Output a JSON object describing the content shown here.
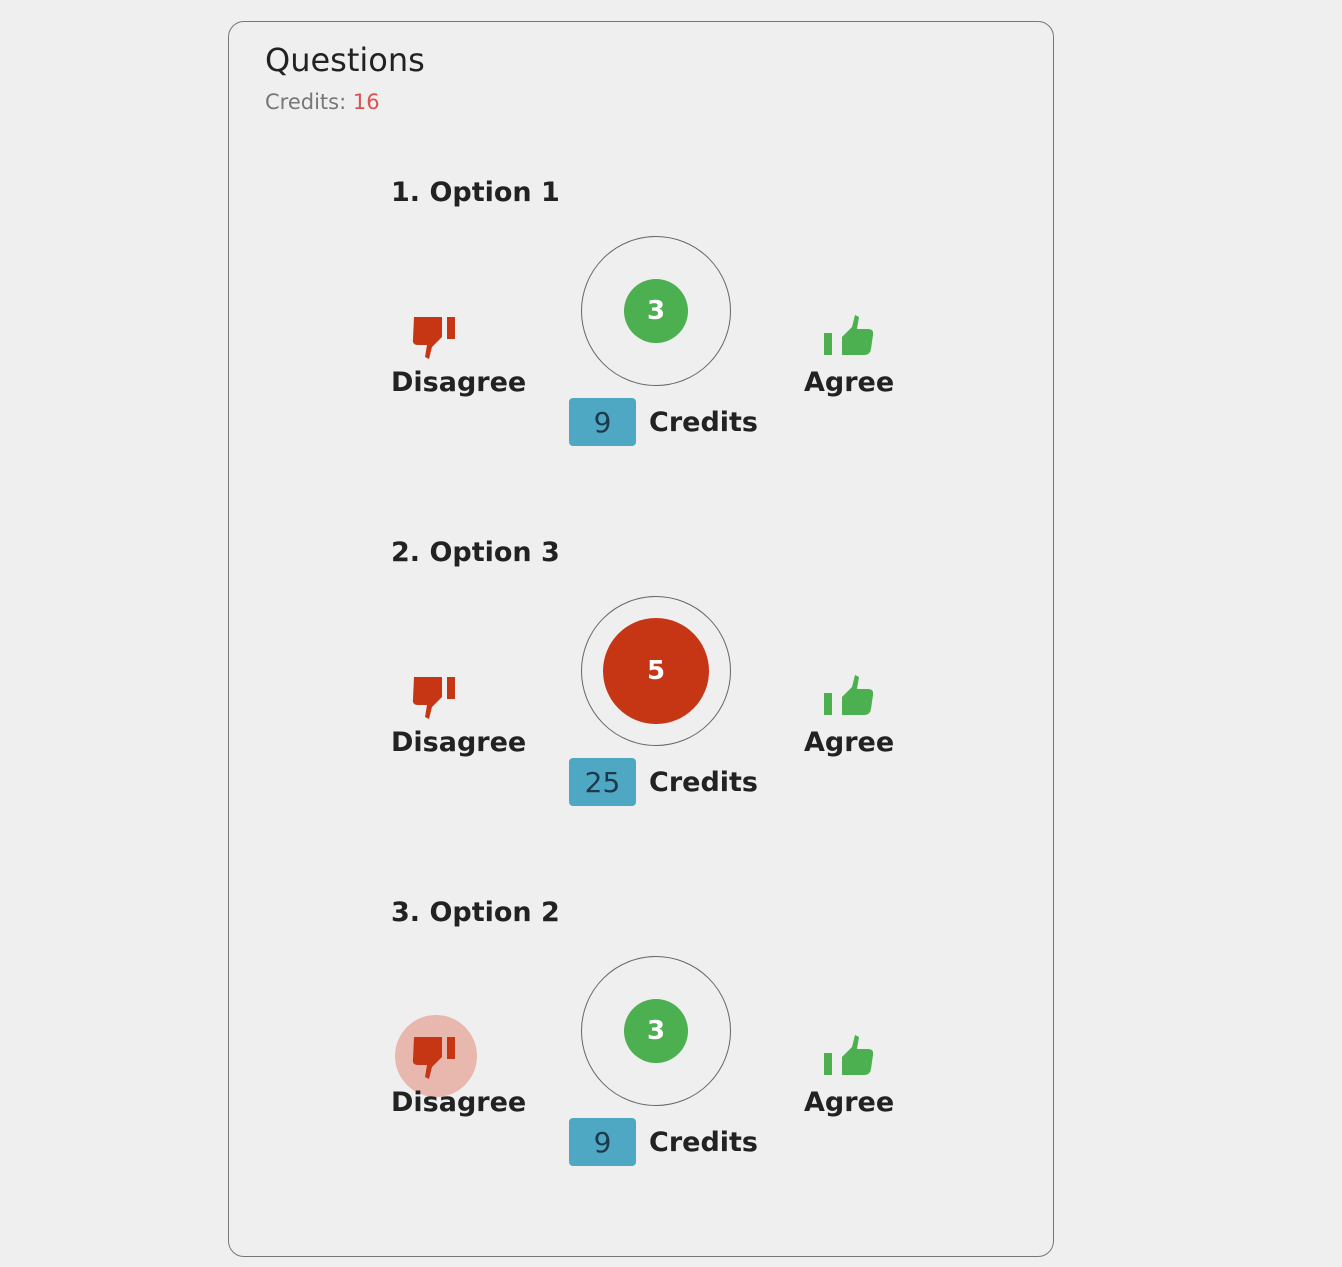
{
  "header": {
    "title": "Questions",
    "credits_label": "Credits:",
    "credits_value": "16"
  },
  "colors": {
    "disagree": "#c63614",
    "agree": "#4caf50",
    "badge": "#4fa8c3",
    "remaining_credits": "#d9534f"
  },
  "questions": [
    {
      "title": "1. Option 1",
      "disagree_label": "Disagree",
      "agree_label": "Agree",
      "votes": "3",
      "vote_direction": "agree",
      "credits_cost": "9",
      "credits_label": "Credits",
      "disagree_active": false,
      "icons": {
        "disagree": "thumbs-down-icon",
        "agree": "thumbs-up-icon"
      }
    },
    {
      "title": "2. Option 3",
      "disagree_label": "Disagree",
      "agree_label": "Agree",
      "votes": "5",
      "vote_direction": "disagree",
      "credits_cost": "25",
      "credits_label": "Credits",
      "disagree_active": false,
      "icons": {
        "disagree": "thumbs-down-icon",
        "agree": "thumbs-up-icon"
      }
    },
    {
      "title": "3. Option 2",
      "disagree_label": "Disagree",
      "agree_label": "Agree",
      "votes": "3",
      "vote_direction": "agree",
      "credits_cost": "9",
      "credits_label": "Credits",
      "disagree_active": true,
      "icons": {
        "disagree": "thumbs-down-icon",
        "agree": "thumbs-up-icon"
      }
    }
  ]
}
